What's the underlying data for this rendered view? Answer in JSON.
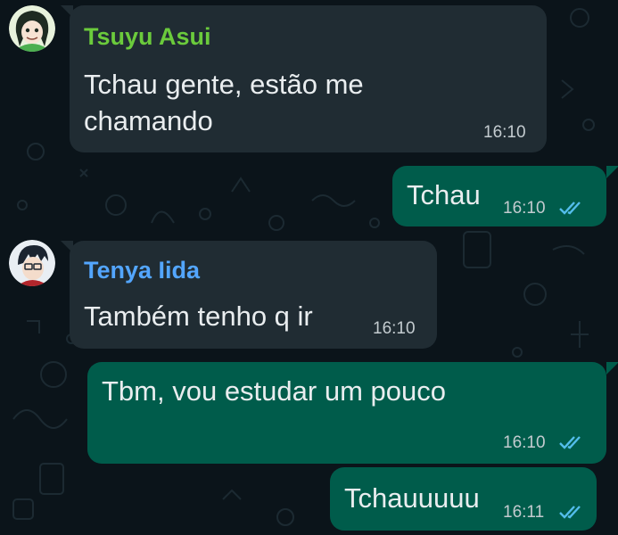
{
  "colors": {
    "background": "#0b141a",
    "incoming_bubble": "#202c33",
    "outgoing_bubble": "#005c4b",
    "tsuyu_name": "#6bcb3c",
    "tenya_name": "#53a6ff",
    "read_ticks": "#53bdeb"
  },
  "messages": [
    {
      "direction": "incoming",
      "sender": "Tsuyu Asui",
      "avatar": "tsuyu-avatar-icon",
      "lines": [
        "Tchau gente, estão me",
        "chamando"
      ],
      "time": "16:10"
    },
    {
      "direction": "outgoing",
      "lines": [
        "Tchau"
      ],
      "time": "16:10",
      "status": "read"
    },
    {
      "direction": "incoming",
      "sender": "Tenya Iida",
      "avatar": "tenya-avatar-icon",
      "lines": [
        "Também tenho q ir"
      ],
      "time": "16:10"
    },
    {
      "direction": "outgoing",
      "lines": [
        "Tbm, vou estudar um pouco"
      ],
      "time": "16:10",
      "status": "read"
    },
    {
      "direction": "outgoing",
      "lines": [
        "Tchauuuuu"
      ],
      "time": "16:11",
      "status": "read"
    }
  ]
}
